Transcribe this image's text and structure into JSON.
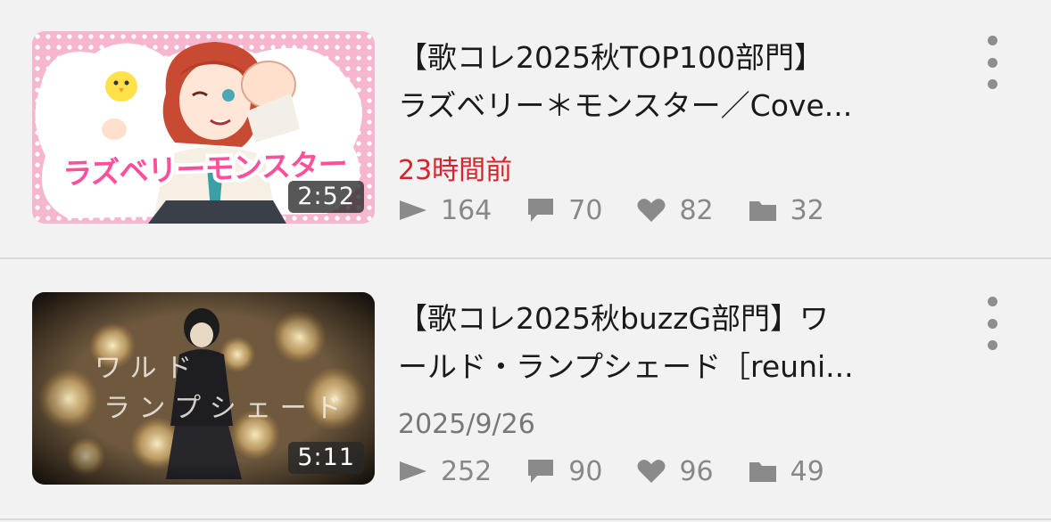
{
  "videos": [
    {
      "duration": "2:52",
      "overlay_title": "ラズベリーモンスター",
      "title_line1": "【歌コレ2025秋TOP100部門】",
      "title_line2": "ラズベリー＊モンスター／Cove...",
      "date": "23時間前",
      "date_color": "#d8232a",
      "views": "164",
      "comments": "70",
      "likes": "82",
      "mylists": "32"
    },
    {
      "duration": "5:11",
      "title_line1": "【歌コレ2025秋buzzG部門】ワ",
      "title_line2": "ールド・ランプシェード［reuni...",
      "date": "2025/9/26",
      "views": "252",
      "comments": "90",
      "likes": "96",
      "mylists": "49"
    }
  ],
  "icons": {
    "views": "play-icon",
    "comments": "comment-icon",
    "likes": "heart-icon",
    "mylists": "folder-icon",
    "menu": "more-vertical-icon"
  }
}
